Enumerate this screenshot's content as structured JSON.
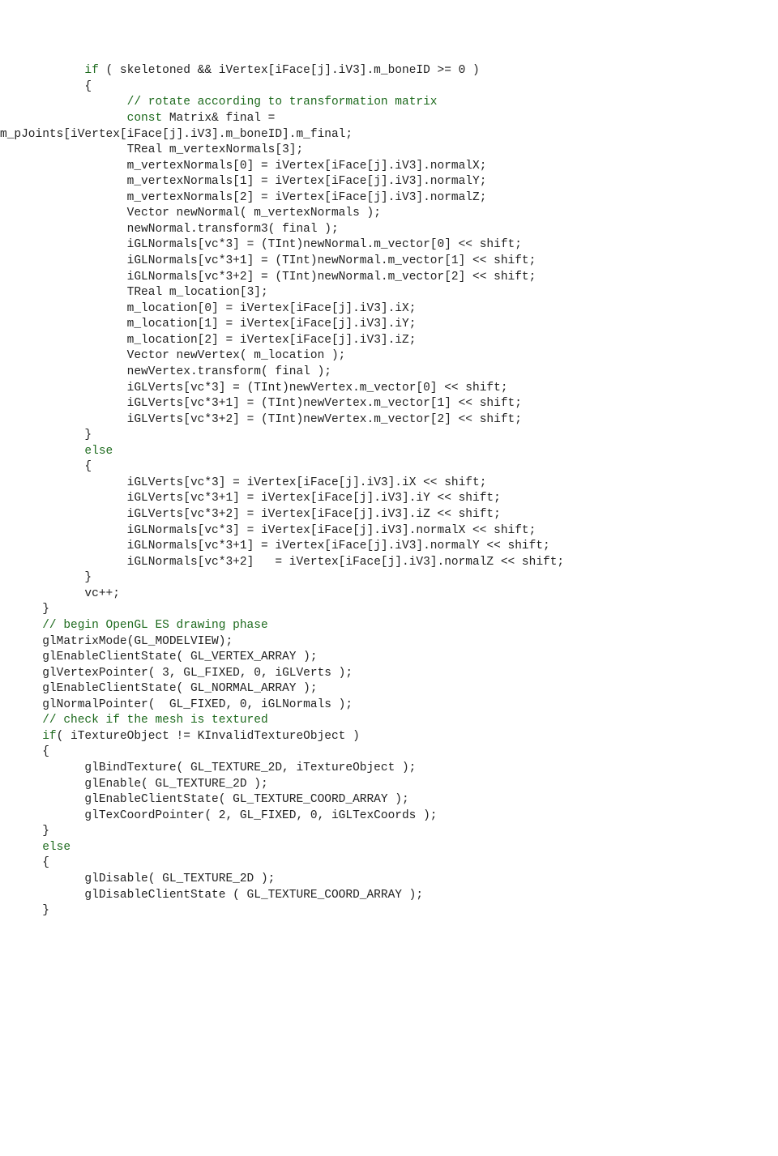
{
  "lines": [
    {
      "indent": 12,
      "segments": [
        {
          "t": "if",
          "c": "kw"
        },
        {
          "t": " ( skeletoned && iVertex[iFace[j].iV3].m_boneID >= 0 )"
        }
      ]
    },
    {
      "indent": 12,
      "segments": [
        {
          "t": "{"
        }
      ]
    },
    {
      "indent": 18,
      "segments": [
        {
          "t": "// rotate according to transformation matrix",
          "c": "cm"
        }
      ]
    },
    {
      "indent": 18,
      "segments": [
        {
          "t": "const",
          "c": "kw"
        },
        {
          "t": " Matrix& final = "
        }
      ]
    },
    {
      "indent": 0,
      "segments": [
        {
          "t": "m_pJoints[iVertex[iFace[j].iV3].m_boneID].m_final;"
        }
      ]
    },
    {
      "indent": 0,
      "segments": [
        {
          "t": ""
        }
      ]
    },
    {
      "indent": 18,
      "segments": [
        {
          "t": "TReal m_vertexNormals[3];"
        }
      ]
    },
    {
      "indent": 18,
      "segments": [
        {
          "t": "m_vertexNormals[0] = iVertex[iFace[j].iV3].normalX;"
        }
      ]
    },
    {
      "indent": 18,
      "segments": [
        {
          "t": "m_vertexNormals[1] = iVertex[iFace[j].iV3].normalY;"
        }
      ]
    },
    {
      "indent": 18,
      "segments": [
        {
          "t": "m_vertexNormals[2] = iVertex[iFace[j].iV3].normalZ;"
        }
      ]
    },
    {
      "indent": 0,
      "segments": [
        {
          "t": ""
        }
      ]
    },
    {
      "indent": 18,
      "segments": [
        {
          "t": "Vector newNormal( m_vertexNormals );"
        }
      ]
    },
    {
      "indent": 18,
      "segments": [
        {
          "t": "newNormal.transform3( final );"
        }
      ]
    },
    {
      "indent": 18,
      "segments": [
        {
          "t": "iGLNormals[vc*3] = (TInt)newNormal.m_vector[0] << shift;"
        }
      ]
    },
    {
      "indent": 18,
      "segments": [
        {
          "t": "iGLNormals[vc*3+1] = (TInt)newNormal.m_vector[1] << shift;"
        }
      ]
    },
    {
      "indent": 18,
      "segments": [
        {
          "t": "iGLNormals[vc*3+2] = (TInt)newNormal.m_vector[2] << shift;"
        }
      ]
    },
    {
      "indent": 0,
      "segments": [
        {
          "t": ""
        }
      ]
    },
    {
      "indent": 18,
      "segments": [
        {
          "t": "TReal m_location[3];"
        }
      ]
    },
    {
      "indent": 18,
      "segments": [
        {
          "t": "m_location[0] = iVertex[iFace[j].iV3].iX;"
        }
      ]
    },
    {
      "indent": 18,
      "segments": [
        {
          "t": "m_location[1] = iVertex[iFace[j].iV3].iY;"
        }
      ]
    },
    {
      "indent": 18,
      "segments": [
        {
          "t": "m_location[2] = iVertex[iFace[j].iV3].iZ;"
        }
      ]
    },
    {
      "indent": 0,
      "segments": [
        {
          "t": ""
        }
      ]
    },
    {
      "indent": 18,
      "segments": [
        {
          "t": "Vector newVertex( m_location );"
        }
      ]
    },
    {
      "indent": 18,
      "segments": [
        {
          "t": "newVertex.transform( final );"
        }
      ]
    },
    {
      "indent": 18,
      "segments": [
        {
          "t": "iGLVerts[vc*3] = (TInt)newVertex.m_vector[0] << shift;"
        }
      ]
    },
    {
      "indent": 18,
      "segments": [
        {
          "t": "iGLVerts[vc*3+1] = (TInt)newVertex.m_vector[1] << shift;"
        }
      ]
    },
    {
      "indent": 18,
      "segments": [
        {
          "t": "iGLVerts[vc*3+2] = (TInt)newVertex.m_vector[2] << shift;"
        }
      ]
    },
    {
      "indent": 12,
      "segments": [
        {
          "t": "}"
        }
      ]
    },
    {
      "indent": 12,
      "segments": [
        {
          "t": "else",
          "c": "kw"
        }
      ]
    },
    {
      "indent": 12,
      "segments": [
        {
          "t": "{"
        }
      ]
    },
    {
      "indent": 18,
      "segments": [
        {
          "t": "iGLVerts[vc*3] = iVertex[iFace[j].iV3].iX << shift;"
        }
      ]
    },
    {
      "indent": 18,
      "segments": [
        {
          "t": "iGLVerts[vc*3+1] = iVertex[iFace[j].iV3].iY << shift;"
        }
      ]
    },
    {
      "indent": 18,
      "segments": [
        {
          "t": "iGLVerts[vc*3+2] = iVertex[iFace[j].iV3].iZ << shift;"
        }
      ]
    },
    {
      "indent": 18,
      "segments": [
        {
          "t": "iGLNormals[vc*3] = iVertex[iFace[j].iV3].normalX << shift;"
        }
      ]
    },
    {
      "indent": 18,
      "segments": [
        {
          "t": "iGLNormals[vc*3+1] = iVertex[iFace[j].iV3].normalY << shift;"
        }
      ]
    },
    {
      "indent": 18,
      "segments": [
        {
          "t": "iGLNormals[vc*3+2]   = iVertex[iFace[j].iV3].normalZ << shift;"
        }
      ]
    },
    {
      "indent": 12,
      "segments": [
        {
          "t": "}"
        }
      ]
    },
    {
      "indent": 12,
      "segments": [
        {
          "t": "vc++;"
        }
      ]
    },
    {
      "indent": 6,
      "segments": [
        {
          "t": "}"
        }
      ]
    },
    {
      "indent": 0,
      "segments": [
        {
          "t": ""
        }
      ]
    },
    {
      "indent": 6,
      "segments": [
        {
          "t": "// begin OpenGL ES drawing phase",
          "c": "cm"
        }
      ]
    },
    {
      "indent": 0,
      "segments": [
        {
          "t": ""
        }
      ]
    },
    {
      "indent": 6,
      "segments": [
        {
          "t": "glMatrixMode(GL_MODELVIEW);"
        }
      ]
    },
    {
      "indent": 0,
      "segments": [
        {
          "t": ""
        }
      ]
    },
    {
      "indent": 6,
      "segments": [
        {
          "t": "glEnableClientState( GL_VERTEX_ARRAY );"
        }
      ]
    },
    {
      "indent": 6,
      "segments": [
        {
          "t": "glVertexPointer( 3, GL_FIXED, 0, iGLVerts );"
        }
      ]
    },
    {
      "indent": 0,
      "segments": [
        {
          "t": ""
        }
      ]
    },
    {
      "indent": 6,
      "segments": [
        {
          "t": "glEnableClientState( GL_NORMAL_ARRAY );"
        }
      ]
    },
    {
      "indent": 6,
      "segments": [
        {
          "t": "glNormalPointer(  GL_FIXED, 0, iGLNormals );"
        }
      ]
    },
    {
      "indent": 0,
      "segments": [
        {
          "t": ""
        }
      ]
    },
    {
      "indent": 6,
      "segments": [
        {
          "t": "// check if the mesh is textured",
          "c": "cm"
        }
      ]
    },
    {
      "indent": 6,
      "segments": [
        {
          "t": "if",
          "c": "kw"
        },
        {
          "t": "( iTextureObject != KInvalidTextureObject )"
        }
      ]
    },
    {
      "indent": 6,
      "segments": [
        {
          "t": "{"
        }
      ]
    },
    {
      "indent": 12,
      "segments": [
        {
          "t": "glBindTexture( GL_TEXTURE_2D, iTextureObject );"
        }
      ]
    },
    {
      "indent": 12,
      "segments": [
        {
          "t": "glEnable( GL_TEXTURE_2D );"
        }
      ]
    },
    {
      "indent": 12,
      "segments": [
        {
          "t": "glEnableClientState( GL_TEXTURE_COORD_ARRAY );"
        }
      ]
    },
    {
      "indent": 12,
      "segments": [
        {
          "t": "glTexCoordPointer( 2, GL_FIXED, 0, iGLTexCoords );"
        }
      ]
    },
    {
      "indent": 6,
      "segments": [
        {
          "t": "}"
        }
      ]
    },
    {
      "indent": 6,
      "segments": [
        {
          "t": "else",
          "c": "kw"
        }
      ]
    },
    {
      "indent": 6,
      "segments": [
        {
          "t": "{"
        }
      ]
    },
    {
      "indent": 12,
      "segments": [
        {
          "t": "glDisable( GL_TEXTURE_2D );"
        }
      ]
    },
    {
      "indent": 12,
      "segments": [
        {
          "t": "glDisableClientState ( GL_TEXTURE_COORD_ARRAY );"
        }
      ]
    },
    {
      "indent": 6,
      "segments": [
        {
          "t": "}"
        }
      ]
    }
  ]
}
